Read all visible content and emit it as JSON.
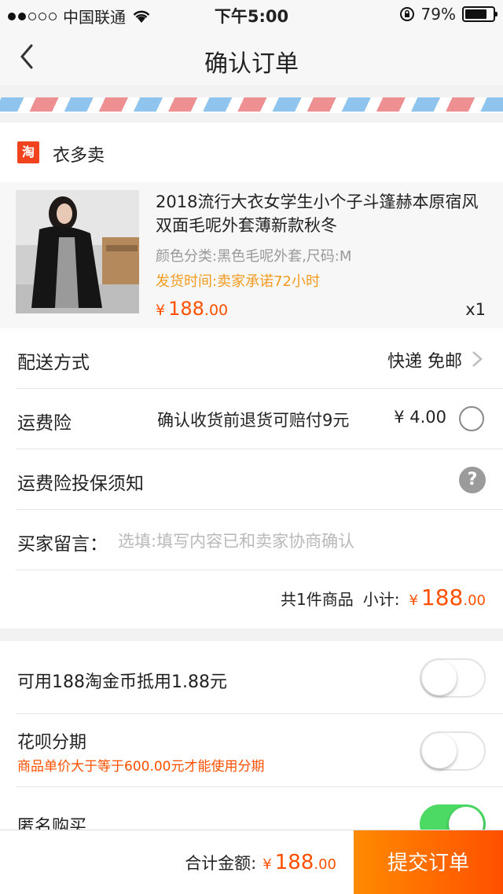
{
  "status_bar": {
    "carrier": "中国联通",
    "time": "下午5:00",
    "battery": "79%",
    "battery_level": 0.79,
    "icons": [
      "signal-dots-icon",
      "wifi-icon",
      "rotation-lock-icon",
      "battery-icon"
    ]
  },
  "nav": {
    "title": "确认订单",
    "back_icon": "chevron-left-icon"
  },
  "shop": {
    "icon_char": "淘",
    "name": "衣多卖"
  },
  "product": {
    "title": "2018流行大衣女学生小个子斗篷赫本原宿风双面毛呢外套薄新款秋冬",
    "spec": "颜色分类:黑色毛呢外套,尺码:M",
    "shipping": "发货时间:卖家承诺72小时",
    "price_symbol": "¥",
    "price_int": "188",
    "price_dec": ".00",
    "quantity": "x1"
  },
  "delivery": {
    "label": "配送方式",
    "value": "快递 免邮"
  },
  "insurance": {
    "label": "运费险",
    "desc": "确认收货前退货可赔付9元",
    "price": "¥ 4.00",
    "selected": false
  },
  "insurance_notice": {
    "label": "运费险投保须知",
    "help_char": "?"
  },
  "message": {
    "label": "买家留言：",
    "placeholder": "选填:填写内容已和卖家协商确认"
  },
  "subtotal": {
    "count": "共1件商品",
    "label": "小计:",
    "symbol": "¥",
    "int": "188",
    "dec": ".00"
  },
  "options": {
    "coins_label": "可用188淘金币抵用1.88元",
    "coins_on": false,
    "huabei_label": "花呗分期",
    "huabei_note": "商品单价大于等于600.00元才能使用分期",
    "huabei_on": false,
    "anon_label": "匿名购买",
    "anon_on": true
  },
  "footer": {
    "total_label": "合计金额:",
    "symbol": "¥",
    "int": "188",
    "dec": ".00",
    "submit_label": "提交订单"
  },
  "colors": {
    "accent": "#ff5000",
    "shipping_text": "#f29b1f",
    "toggle_on": "#4cd964"
  }
}
